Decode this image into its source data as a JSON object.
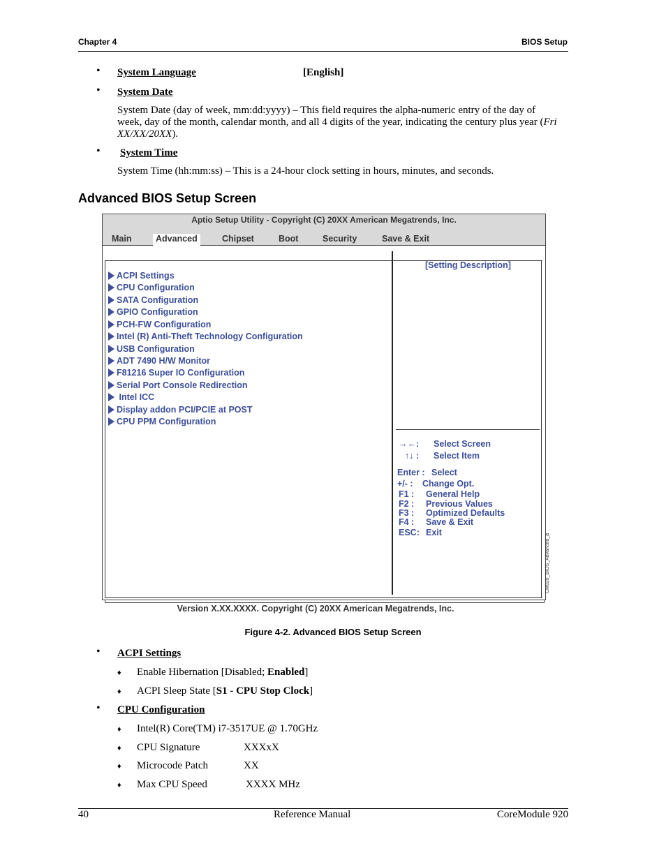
{
  "header": {
    "chapter": "Chapter 4",
    "section": "BIOS Setup"
  },
  "intro_items": [
    {
      "title": "System Language",
      "value": "[English]"
    },
    {
      "title": "System Date",
      "text": "System Date (day of week, mm:dd:yyyy) – This field requires the alpha-numeric entry of the day of week, day of the month, calendar month, and all 4 digits of the year, indicating the century plus year (",
      "italic": "Fri  XX/XX/20XX",
      "text_end": ")."
    },
    {
      "title": "System Time",
      "text": "System Time (hh:mm:ss) – This is a 24-hour clock setting in hours, minutes, and seconds."
    }
  ],
  "section_title": "Advanced BIOS Setup Screen",
  "bios": {
    "title": "Aptio Setup Utility   -   Copyright (C) 20XX American Megatrends, Inc.",
    "tabs": [
      "Main",
      "Advanced",
      "Chipset",
      "Boot",
      "Security",
      "Save & Exit"
    ],
    "active_tab": "Advanced",
    "menu_items": [
      "ACPI Settings",
      "CPU Configuration",
      "SATA Configuration",
      "GPIO Configuration",
      "PCH-FW Configuration",
      "Intel (R) Anti-Theft Technology Configuration",
      "USB Configuration",
      "ADT 7490 H/W Monitor",
      "F81216 Super IO Configuration",
      "Serial Port Console Redirection",
      " Intel ICC",
      "Display addon PCI/PCIE at POST",
      "CPU PPM Configuration"
    ],
    "description_title": "[Setting Description]",
    "keys": [
      {
        "key": "→←:",
        "action": "Select Screen"
      },
      {
        "key": "↑↓ :",
        "action": "Select Item"
      },
      {
        "key": "Enter :",
        "action": "Select"
      },
      {
        "key": "+/- :",
        "action": "Change Opt."
      },
      {
        "key": "F1 :",
        "action": "General Help"
      },
      {
        "key": "F2 :",
        "action": "Previous Values"
      },
      {
        "key": "F3 :",
        "action": "Optimized Defaults"
      },
      {
        "key": "F4 :",
        "action": "Save & Exit"
      },
      {
        "key": "ESC:",
        "action": "Exit"
      }
    ],
    "footer": "Version X.XX.XXXX.  Copyright (C) 20XX  American Megatrends, Inc.",
    "image_id": "CM920_BIOS_Advanced_a",
    "colors": {
      "text_blue": "#3d4f9a",
      "header_gray": "#d9d9d9"
    }
  },
  "figure_caption": "Figure  4-2.   Advanced BIOS Setup Screen",
  "details": [
    {
      "title": "ACPI Settings",
      "subitems": [
        {
          "prefix": "Enable Hibernation [Disabled; ",
          "bold": "Enabled",
          "suffix": "]"
        },
        {
          "prefix": "ACPI Sleep State [",
          "bold": "S1 - CPU Stop Clock",
          "suffix": "]"
        }
      ]
    },
    {
      "title": "CPU Configuration",
      "subitems": [
        {
          "label": "Intel(R) Core(TM) i7-3517UE @ 1.70GHz",
          "value": ""
        },
        {
          "label": "CPU Signature",
          "value": "XXXxX"
        },
        {
          "label": "Microcode Patch",
          "value": "XX"
        },
        {
          "label": "Max CPU Speed",
          "value": "XXXX MHz"
        }
      ]
    }
  ],
  "footer": {
    "page": "40",
    "center": "Reference Manual",
    "right": "CoreModule 920"
  }
}
